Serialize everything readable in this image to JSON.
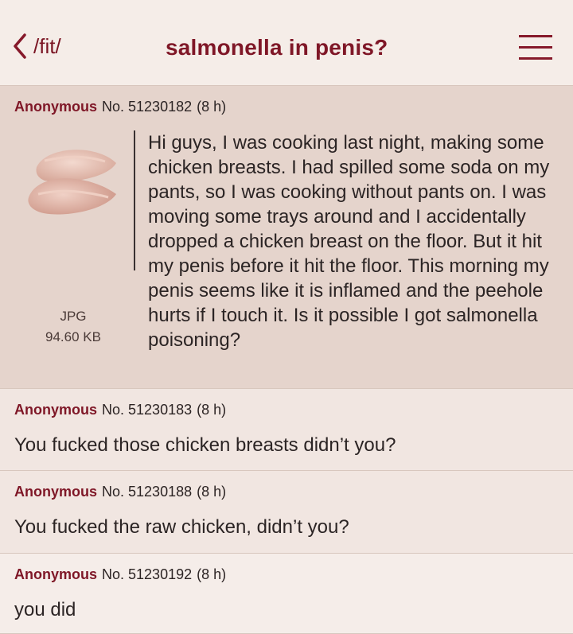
{
  "header": {
    "board": "/fit/",
    "title": "salmonella in penis?"
  },
  "posts": [
    {
      "name": "Anonymous",
      "number": "No. 51230182",
      "time": "(8 h)",
      "image": {
        "type": "JPG",
        "size": "94.60 KB"
      },
      "text": "Hi guys, I was cooking last night, making some chicken breasts. I had spilled some soda on my pants, so I was cooking without pants on. I was moving some trays around and I accidentally dropped a chicken breast on the floor. But it hit my penis before it hit the floor. This morning my penis seems like it is inflamed and the peehole hurts if I touch it. Is it possible I got salmonella poisoning?"
    },
    {
      "name": "Anonymous",
      "number": "No. 51230183",
      "time": "(8 h)",
      "text": "You fucked those chicken breasts didn’t you?"
    },
    {
      "name": "Anonymous",
      "number": "No. 51230188",
      "time": "(8 h)",
      "text": "You fucked the raw chicken, didn’t you?"
    },
    {
      "name": "Anonymous",
      "number": "No. 51230192",
      "time": "(8 h)",
      "text": "you did"
    }
  ],
  "colors": {
    "accent": "#7f1727",
    "background": "#f0e6df",
    "op_background": "#e5d4cc",
    "reply_background": "#f1e6e1"
  },
  "icons": {
    "back": "chevron-left-icon",
    "menu": "hamburger-menu-icon"
  }
}
